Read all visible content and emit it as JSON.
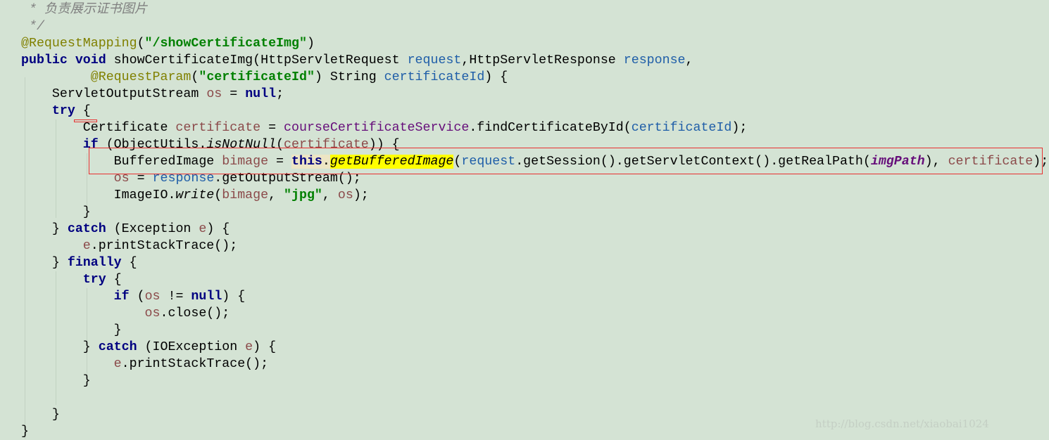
{
  "colors": {
    "background": "#d4e3d4",
    "keyword": "#000080",
    "string": "#008000",
    "annotation": "#808000",
    "highlight": "#ffff00",
    "error_box": "#e83030"
  },
  "code_lines": [
    {
      "indent": 1,
      "tokens": [
        [
          "* 负责展示证书图片",
          "cmt"
        ]
      ]
    },
    {
      "indent": 1,
      "tokens": [
        [
          "*/",
          "cmt"
        ]
      ]
    },
    {
      "indent": 0,
      "tokens": [
        [
          "@RequestMapping",
          "ann"
        ],
        [
          "(",
          ""
        ],
        [
          "\"/showCertificateImg\"",
          "str"
        ],
        [
          ")",
          ""
        ]
      ]
    },
    {
      "indent": 0,
      "tokens": [
        [
          "public",
          "kw"
        ],
        [
          " ",
          ""
        ],
        [
          "void",
          "kw"
        ],
        [
          " showCertificateImg(HttpServletRequest ",
          ""
        ],
        [
          "request",
          "param"
        ],
        [
          ",HttpServletResponse ",
          ""
        ],
        [
          "response",
          "param"
        ],
        [
          ",",
          ""
        ]
      ]
    },
    {
      "indent": 9,
      "tokens": [
        [
          "@RequestParam",
          "ann"
        ],
        [
          "(",
          ""
        ],
        [
          "\"certificateId\"",
          "str"
        ],
        [
          ") String ",
          ""
        ],
        [
          "certificateId",
          "param"
        ],
        [
          ") {",
          ""
        ]
      ]
    },
    {
      "indent": 4,
      "tokens": [
        [
          "ServletOutputStream ",
          ""
        ],
        [
          "os",
          "var"
        ],
        [
          " = ",
          ""
        ],
        [
          "null",
          "kw"
        ],
        [
          ";",
          ""
        ]
      ]
    },
    {
      "indent": 4,
      "tokens": [
        [
          "try",
          "kw"
        ],
        [
          " {",
          ""
        ]
      ]
    },
    {
      "indent": 8,
      "tokens": [
        [
          "Certificate ",
          ""
        ],
        [
          "certificate",
          "var"
        ],
        [
          " = ",
          ""
        ],
        [
          "courseCertificateService",
          "field"
        ],
        [
          ".findCertificateById(",
          ""
        ],
        [
          "certificateId",
          "param"
        ],
        [
          ");",
          ""
        ]
      ]
    },
    {
      "indent": 8,
      "tokens": [
        [
          "if",
          "kw"
        ],
        [
          " (ObjectUtils.",
          ""
        ],
        [
          "isNotNull",
          "ital"
        ],
        [
          "(",
          ""
        ],
        [
          "certificate",
          "var"
        ],
        [
          ")) {",
          ""
        ]
      ]
    },
    {
      "indent": 12,
      "tokens": [
        [
          "BufferedImage ",
          ""
        ],
        [
          "bimage",
          "var"
        ],
        [
          " = ",
          ""
        ],
        [
          "this",
          "kw thisbg"
        ],
        [
          ".",
          "thisbg"
        ],
        [
          "getBufferedImage",
          "hl"
        ],
        [
          "(",
          ""
        ],
        [
          "request",
          "param"
        ],
        [
          ".getSession().getServletContext().getRealPath(",
          ""
        ],
        [
          "imgPath",
          "const"
        ],
        [
          "), ",
          ""
        ],
        [
          "certificate",
          "var"
        ],
        [
          ");",
          ""
        ]
      ]
    },
    {
      "indent": 12,
      "tokens": [
        [
          "os",
          "var"
        ],
        [
          " = ",
          ""
        ],
        [
          "response",
          "param"
        ],
        [
          ".getOutputStream();",
          ""
        ]
      ]
    },
    {
      "indent": 12,
      "tokens": [
        [
          "ImageIO.",
          ""
        ],
        [
          "write",
          "ital"
        ],
        [
          "(",
          ""
        ],
        [
          "bimage",
          "var"
        ],
        [
          ", ",
          ""
        ],
        [
          "\"jpg\"",
          "str"
        ],
        [
          ", ",
          ""
        ],
        [
          "os",
          "var"
        ],
        [
          ");",
          ""
        ]
      ]
    },
    {
      "indent": 8,
      "tokens": [
        [
          "}",
          ""
        ]
      ]
    },
    {
      "indent": 4,
      "tokens": [
        [
          "} ",
          ""
        ],
        [
          "catch",
          "kw"
        ],
        [
          " (Exception ",
          ""
        ],
        [
          "e",
          "var"
        ],
        [
          ") {",
          ""
        ]
      ]
    },
    {
      "indent": 8,
      "tokens": [
        [
          "e",
          "var"
        ],
        [
          ".printStackTrace();",
          ""
        ]
      ]
    },
    {
      "indent": 4,
      "tokens": [
        [
          "} ",
          ""
        ],
        [
          "finally",
          "kw"
        ],
        [
          " {",
          ""
        ]
      ]
    },
    {
      "indent": 8,
      "tokens": [
        [
          "try",
          "kw"
        ],
        [
          " {",
          ""
        ]
      ]
    },
    {
      "indent": 12,
      "tokens": [
        [
          "if",
          "kw"
        ],
        [
          " (",
          ""
        ],
        [
          "os",
          "var"
        ],
        [
          " != ",
          ""
        ],
        [
          "null",
          "kw"
        ],
        [
          ") {",
          ""
        ]
      ]
    },
    {
      "indent": 16,
      "tokens": [
        [
          "os",
          "var"
        ],
        [
          ".close();",
          ""
        ]
      ]
    },
    {
      "indent": 12,
      "tokens": [
        [
          "}",
          ""
        ]
      ]
    },
    {
      "indent": 8,
      "tokens": [
        [
          "} ",
          ""
        ],
        [
          "catch",
          "kw"
        ],
        [
          " (IOException ",
          ""
        ],
        [
          "e",
          "var"
        ],
        [
          ") {",
          ""
        ]
      ]
    },
    {
      "indent": 12,
      "tokens": [
        [
          "e",
          "var"
        ],
        [
          ".printStackTrace();",
          ""
        ]
      ]
    },
    {
      "indent": 8,
      "tokens": [
        [
          "}",
          ""
        ]
      ]
    },
    {
      "indent": 0,
      "tokens": []
    },
    {
      "indent": 4,
      "tokens": [
        [
          "}",
          ""
        ]
      ]
    },
    {
      "indent": 0,
      "tokens": [
        [
          "}",
          ""
        ]
      ]
    }
  ],
  "watermark": "http://blog.csdn.net/xiaobai1024"
}
